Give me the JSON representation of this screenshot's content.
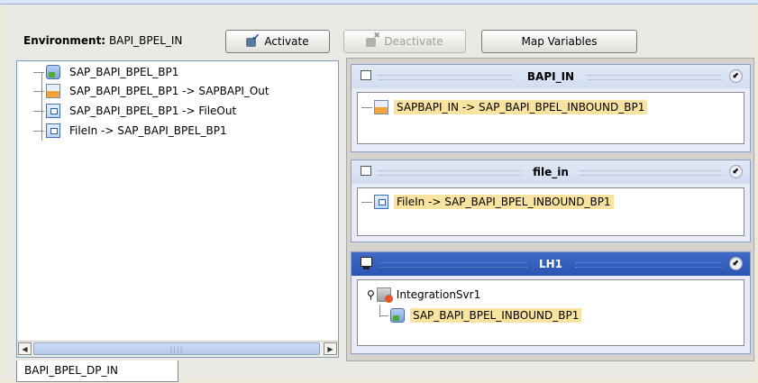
{
  "toolbar": {
    "environment_label": "Environment:",
    "environment_value": "BAPI_BPEL_IN",
    "activate_label": "Activate",
    "deactivate_label": "Deactivate",
    "map_variables_label": "Map Variables"
  },
  "tree": {
    "items": [
      {
        "label": "SAP_BAPI_BPEL_BP1",
        "icon": "business-process-icon"
      },
      {
        "label": "SAP_BAPI_BPEL_BP1 -> SAPBAPI_Out",
        "icon": "sap-bapi-icon"
      },
      {
        "label": "SAP_BAPI_BPEL_BP1 -> FileOut",
        "icon": "file-icon"
      },
      {
        "label": "FileIn -> SAP_BAPI_BPEL_BP1",
        "icon": "file-icon"
      }
    ]
  },
  "panels": {
    "bapi_in": {
      "title": "BAPI_IN",
      "item": "SAPBAPI_IN -> SAP_BAPI_BPEL_INBOUND_BP1",
      "item_icon": "sap-bapi-icon"
    },
    "file_in": {
      "title": "file_in",
      "item": "FileIn -> SAP_BAPI_BPEL_INBOUND_BP1",
      "item_icon": "file-icon"
    },
    "lh1": {
      "title": "LH1",
      "server": "IntegrationSvr1",
      "server_icon": "integration-server-icon",
      "deployed": "SAP_BAPI_BPEL_INBOUND_BP1",
      "deployed_icon": "business-process-icon"
    }
  },
  "bottom_tab": {
    "label": "BAPI_BPEL_DP_IN"
  },
  "colors": {
    "highlight": "#f8e3a0",
    "active_title": "#2a55b4",
    "inactive_title": "#d3ddf1"
  }
}
